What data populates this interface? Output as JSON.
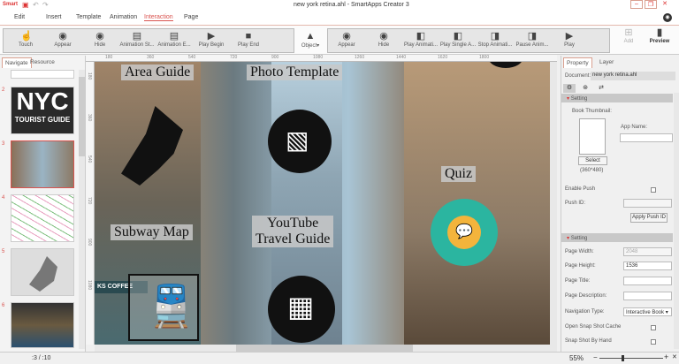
{
  "app": {
    "logo": "Smart",
    "title": "new york retina.ahl - SmartApps Creator 3"
  },
  "menu": [
    "Edit",
    "Insert",
    "Template",
    "Animation",
    "Interaction",
    "Page"
  ],
  "menu_active": "Interaction",
  "toolbar": {
    "group1": [
      {
        "label": "Touch",
        "icon": "touch-icon"
      },
      {
        "label": "Appear",
        "icon": "eye-icon"
      },
      {
        "label": "Hide",
        "icon": "eye-icon"
      },
      {
        "label": "Animation St...",
        "icon": "film-icon"
      },
      {
        "label": "Animation E...",
        "icon": "film-icon"
      },
      {
        "label": "Play Begin",
        "icon": "play-icon"
      },
      {
        "label": "Play End",
        "icon": "stop-icon"
      }
    ],
    "object_label": "Object",
    "group2": [
      {
        "label": "Appear",
        "icon": "eye-icon"
      },
      {
        "label": "Hide",
        "icon": "eye-icon"
      },
      {
        "label": "Play Animati...",
        "icon": "animation-icon"
      },
      {
        "label": "Play Single A...",
        "icon": "animation-icon"
      },
      {
        "label": "Stop Animati...",
        "icon": "animation-icon"
      },
      {
        "label": "Pause Anim...",
        "icon": "animation-icon"
      },
      {
        "label": "Play",
        "icon": "play-icon"
      }
    ],
    "add_label": "Add",
    "preview_label": "Preview"
  },
  "left_panel": {
    "tabs": [
      "Navigate",
      "Resource"
    ],
    "pages": [
      "2",
      "3",
      "4",
      "5",
      "6"
    ],
    "nyc_text": "NYC",
    "tourist_text": "TOURIST GUIDE",
    "page_indicator": ":3  /  :10"
  },
  "rulers": {
    "h": [
      "180",
      "360",
      "540",
      "720",
      "900",
      "1080",
      "1260",
      "1440",
      "1620",
      "1800"
    ],
    "v": [
      "180",
      "360",
      "540",
      "720",
      "900",
      "1080"
    ]
  },
  "canvas": {
    "labels": {
      "area": "Area Guide",
      "photo": "Photo Template",
      "quiz": "Quiz",
      "youtube": "YouTube\nTravel Guide",
      "subway": "Subway Map"
    },
    "sign": "KS COFFEE"
  },
  "right_panel": {
    "tabs": [
      "Property",
      "Layer"
    ],
    "document_label": "Document:",
    "document_value": "new york retina.ahl",
    "setting1": "Setting",
    "book_thumbnail": "Book Thumbnail:",
    "app_name": "App Name:",
    "select": "Select",
    "size_hint": "(360*480)",
    "enable_push": "Enable Push",
    "push_id": "Push ID:",
    "apply_push": "Apply Push ID",
    "setting2": "Setting",
    "page_width": "Page Width:",
    "page_width_value": "2048",
    "page_height": "Page Height:",
    "page_height_value": "1536",
    "page_title": "Page Title:",
    "page_description": "Page Description:",
    "navigation_type": "Navigation Type:",
    "navigation_value": "Interactive Book",
    "snap_cache": "Open Snap Shot Cache",
    "snap_hand": "Snap Shot By Hand"
  },
  "status": {
    "zoom": "55%",
    "zoom_fraction": 0.35
  }
}
